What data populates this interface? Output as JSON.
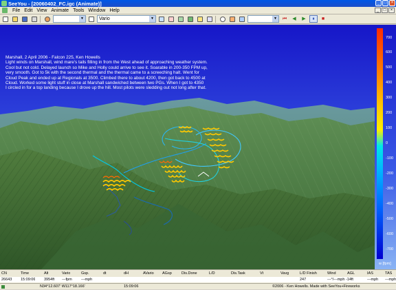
{
  "window": {
    "app_name": "SeeYou",
    "title": "SeeYou - [20060402_FC.igc (Animate)]",
    "controls": [
      "_",
      "□",
      "×"
    ]
  },
  "menu": {
    "items": [
      "File",
      "Edit",
      "View",
      "Animate",
      "Tools",
      "Window",
      "Help"
    ],
    "mdi_controls": [
      "_",
      "□",
      "×"
    ]
  },
  "toolbar": {
    "pilot_combo": "",
    "mode_combo": "Vario",
    "playback_speed_combo": "",
    "playback_buttons": [
      "⏮",
      "◀",
      "▶",
      "⏸",
      "■"
    ]
  },
  "flight": {
    "description": "Marshall, 2 April 2006 - Falcon 225, Ken Howells\nLight winds on Marshall, wind mare's tails filling in from the West ahead of approaching weather system.\nCool but not cold.  Delayed launch so Mike and Holly could arrive to see it.  Soarable in 200-350 FPM up,\nvery smooth.  Got to 5k with the second thermal and the thermal came to a screeching halt.  Went for\nCloud Peak and ended up at Regionals at 3500.  Climbed there to about 4200, then got back to 4500 at\nCloud.  Worked some light stuff in close at Marshall sandwiched between two PGs.  When I got to 4350\nI circled in for a top landing because I drove up the hill.  Most pilots were sledding out not long after that."
  },
  "vario_legend": {
    "ticks": [
      "700",
      "600",
      "500",
      "400",
      "300",
      "200",
      "100",
      "0",
      "-100",
      "-200",
      "-300",
      "-400",
      "-500",
      "-600",
      "-700"
    ],
    "unit": "w [fpm]",
    "colors": {
      "strong_lift": "#ff2a00",
      "lift": "#ffc800",
      "zero": "#00e8e8",
      "sink": "#0064ff",
      "strong_sink": "#0000d0"
    }
  },
  "grid": {
    "headers": [
      "CN",
      "Time",
      "Alt",
      "Vario",
      "Gsp.",
      "dt",
      "dH",
      "AVario",
      "AGsp",
      "Dis.Done",
      "L/D",
      "Dis.Task",
      "Vt",
      "Vavg",
      "L/D Finish",
      "Wind",
      "AGL",
      "IAS",
      "TAS"
    ],
    "values": [
      "26643",
      "15:09:06",
      "3954ft",
      "---fpm",
      "---mph",
      "",
      "",
      "",
      "",
      "",
      "",
      "",
      "",
      "",
      "247",
      "---°/---mph -14ft",
      "",
      "---mph",
      "---mph"
    ]
  },
  "status": {
    "coordinates": "N34°12.607'  W117°18.166'",
    "time": "15:09:06",
    "copyright": "©2006 - Ken Howells. Made with SeeYou+Fireworks"
  }
}
